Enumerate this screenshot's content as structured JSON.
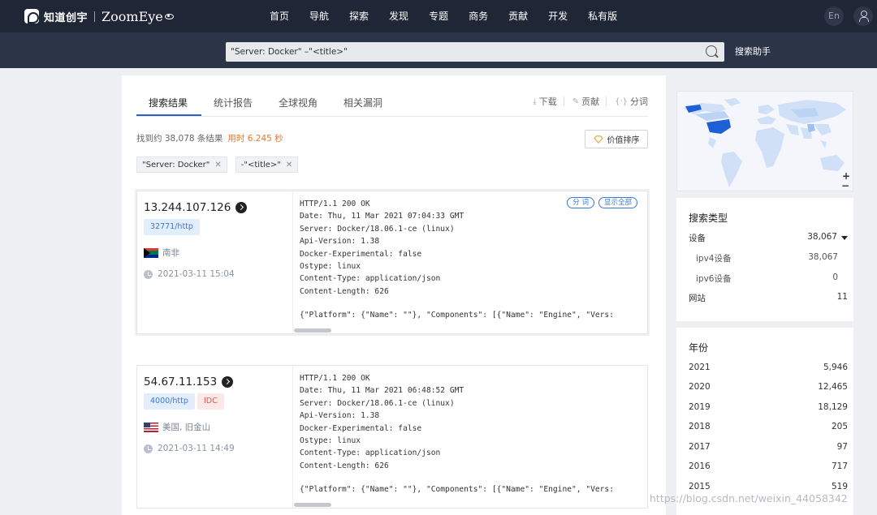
{
  "brand": {
    "cn": "知道创宇",
    "en": "ZoomEye"
  },
  "nav": [
    "首页",
    "导航",
    "探索",
    "发现",
    "专题",
    "商务",
    "贡献",
    "开发",
    "私有版"
  ],
  "lang": "En",
  "search": {
    "query": "\"Server: Docker\" –\"<title>\"",
    "helper": "搜索助手"
  },
  "tabs": [
    "搜索结果",
    "统计报告",
    "全球视角",
    "相关漏洞"
  ],
  "tools": {
    "download": "下载",
    "contribute": "贡献",
    "segment": "分词"
  },
  "summary": {
    "found": "找到约 38,078 条结果",
    "time": "用时 6.245 秒"
  },
  "sort_label": "价值排序",
  "filters": [
    "\"Server: Docker\"",
    "-\"<title>\""
  ],
  "pills": {
    "segment": "分 词",
    "show_all": "显示全部"
  },
  "results": [
    {
      "ip": "13.244.107.126",
      "port": "32771/http",
      "location": "南非",
      "time": "2021-03-11 15:04",
      "banner": "HTTP/1.1 200 OK\nDate: Thu, 11 Mar 2021 07:04:33 GMT\nServer: Docker/18.06.1-ce (linux)\nApi-Version: 1.38\nDocker-Experimental: false\nOstype: linux\nContent-Type: application/json\nContent-Length: 626",
      "json": "{\"Platform\": {\"Name\": \"\"}, \"Components\": [{\"Name\": \"Engine\", \"Vers:"
    },
    {
      "ip": "54.67.11.153",
      "port": "4000/http",
      "tag": "IDC",
      "location": "美国, 旧金山",
      "time": "2021-03-11 14:49",
      "banner": "HTTP/1.1 200 OK\nDate: Thu, 11 Mar 2021 06:48:52 GMT\nServer: Docker/18.06.1-ce (linux)\nApi-Version: 1.38\nDocker-Experimental: false\nOstype: linux\nContent-Type: application/json\nContent-Length: 626",
      "json": "{\"Platform\": {\"Name\": \"\"}, \"Components\": [{\"Name\": \"Engine\", \"Vers:"
    }
  ],
  "search_type": {
    "title": "搜索类型",
    "rows": [
      {
        "label": "设备",
        "value": "38,067"
      },
      {
        "label": "ipv4设备",
        "value": "38,067"
      },
      {
        "label": "ipv6设备",
        "value": "0"
      },
      {
        "label": "网站",
        "value": "11"
      }
    ]
  },
  "year": {
    "title": "年份",
    "rows": [
      {
        "label": "2021",
        "value": "5,946"
      },
      {
        "label": "2020",
        "value": "12,465"
      },
      {
        "label": "2019",
        "value": "18,129"
      },
      {
        "label": "2018",
        "value": "205"
      },
      {
        "label": "2017",
        "value": "97"
      },
      {
        "label": "2016",
        "value": "717"
      },
      {
        "label": "2015",
        "value": "519"
      }
    ]
  },
  "map_zoom": {
    "plus": "+",
    "minus": "−"
  },
  "watermark": "https://blog.csdn.net/weixin_44058342",
  "colors": {
    "nav_bg": "#1f2636",
    "search_bg": "#2c3447",
    "accent": "#2d5ec9",
    "time": "#e6762c",
    "map_us": "#1c5fd6"
  }
}
